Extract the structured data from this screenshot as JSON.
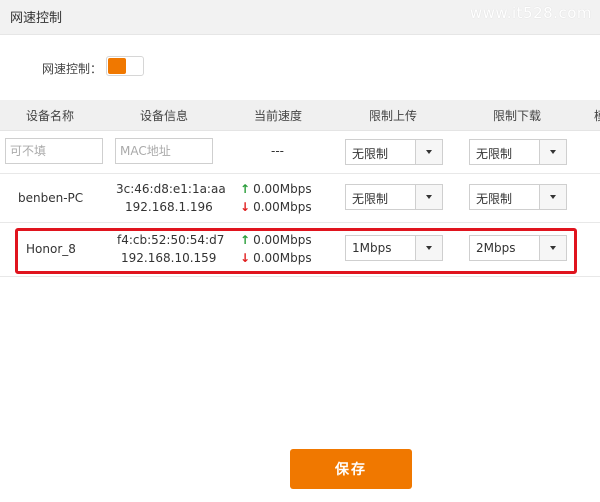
{
  "header": {
    "title": "网速控制"
  },
  "watermark": "www.it528.com",
  "speed_control": {
    "label": "网速控制：",
    "enabled": true
  },
  "table": {
    "columns": [
      "设备名称",
      "设备信息",
      "当前速度",
      "限制上传",
      "限制下载",
      "模"
    ],
    "filter_row": {
      "name_placeholder": "可不填",
      "mac_placeholder": "MAC地址",
      "speed": "---",
      "upload": "无限制",
      "download": "无限制"
    },
    "rows": [
      {
        "name": "benben-PC",
        "mac": "3c:46:d8:e1:1a:aa",
        "ip": "192.168.1.196",
        "up_speed": "0.00Mbps",
        "down_speed": "0.00Mbps",
        "upload": "无限制",
        "download": "无限制"
      },
      {
        "name": "Honor_8",
        "mac": "f4:cb:52:50:54:d7",
        "ip": "192.168.10.159",
        "up_speed": "0.00Mbps",
        "down_speed": "0.00Mbps",
        "upload": "1Mbps",
        "download": "2Mbps"
      }
    ]
  },
  "save_label": "保存",
  "colors": {
    "accent": "#f07800",
    "highlight": "#e0141e",
    "up": "#2a9d3a",
    "down": "#e02020"
  }
}
